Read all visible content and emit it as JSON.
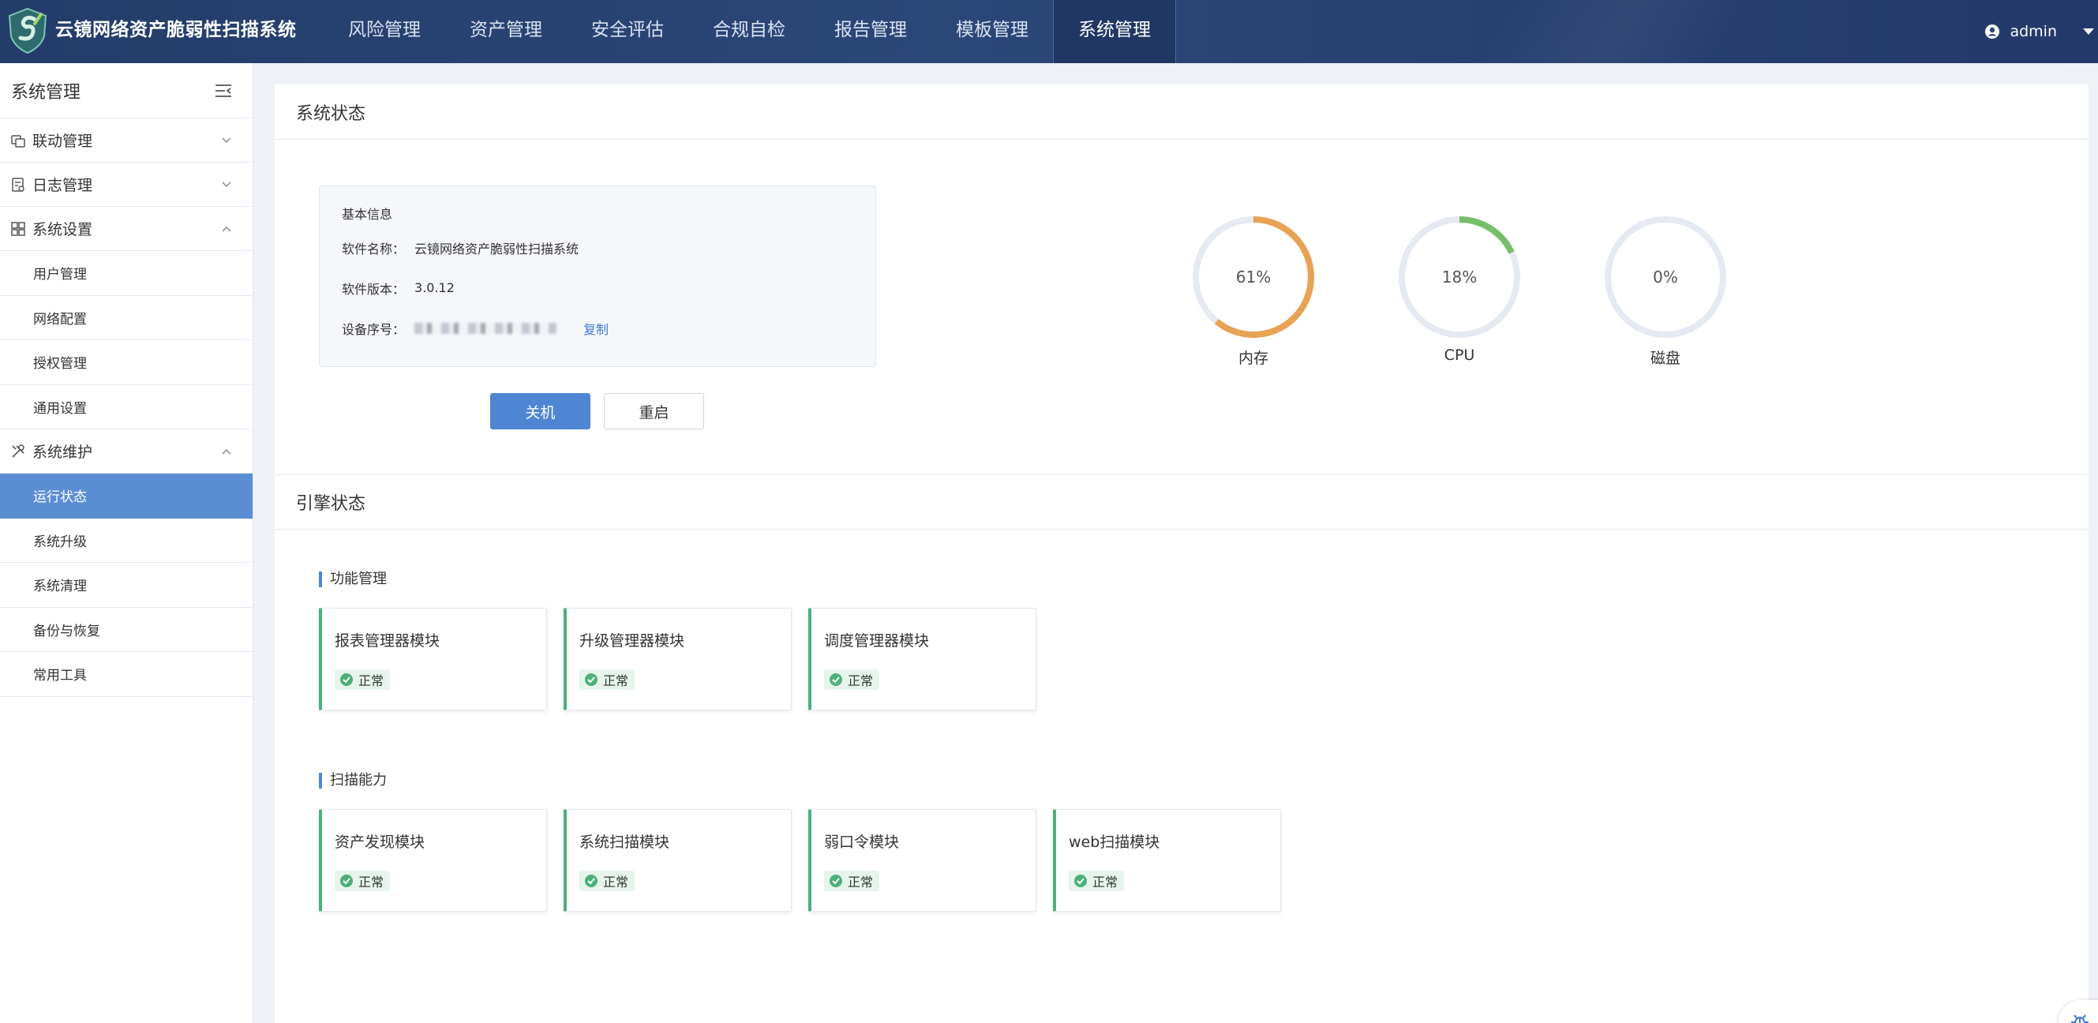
{
  "app": {
    "title": "云镜网络资产脆弱性扫描系统"
  },
  "nav": {
    "items": [
      {
        "label": "风险管理"
      },
      {
        "label": "资产管理"
      },
      {
        "label": "安全评估"
      },
      {
        "label": "合规自检"
      },
      {
        "label": "报告管理"
      },
      {
        "label": "模板管理"
      },
      {
        "label": "系统管理"
      }
    ],
    "active_index": 6
  },
  "user": {
    "name": "admin",
    "icon": "user-circle-icon"
  },
  "sidebar": {
    "title": "系统管理",
    "groups": [
      {
        "label": "联动管理",
        "icon": "linkage-icon",
        "expanded": false,
        "items": []
      },
      {
        "label": "日志管理",
        "icon": "log-icon",
        "expanded": false,
        "items": []
      },
      {
        "label": "系统设置",
        "icon": "grid-icon",
        "expanded": true,
        "items": [
          {
            "label": "用户管理"
          },
          {
            "label": "网络配置"
          },
          {
            "label": "授权管理"
          },
          {
            "label": "通用设置"
          }
        ]
      },
      {
        "label": "系统维护",
        "icon": "tools-icon",
        "expanded": true,
        "items": [
          {
            "label": "运行状态"
          },
          {
            "label": "系统升级"
          },
          {
            "label": "系统清理"
          },
          {
            "label": "备份与恢复"
          },
          {
            "label": "常用工具"
          }
        ]
      }
    ],
    "active_item": "运行状态"
  },
  "system_status": {
    "section_title": "系统状态",
    "basic_info": {
      "title": "基本信息",
      "software_name_label": "软件名称：",
      "software_name": "云镜网络资产脆弱性扫描系统",
      "software_version_label": "软件版本：",
      "software_version": "3.0.12",
      "device_serial_label": "设备序号：",
      "copy_label": "复制"
    },
    "buttons": {
      "shutdown": "关机",
      "restart": "重启"
    },
    "gauges": [
      {
        "label": "内存",
        "percent": 61,
        "display": "61%",
        "color": "#e8a253"
      },
      {
        "label": "CPU",
        "percent": 18,
        "display": "18%",
        "color": "#76bf6a"
      },
      {
        "label": "磁盘",
        "percent": 0,
        "display": "0%",
        "color": "#76bf6a"
      }
    ],
    "gauge_track_color": "#e5e9f1"
  },
  "engine_status": {
    "section_title": "引擎状态",
    "groups": [
      {
        "title": "功能管理",
        "modules": [
          {
            "name": "报表管理器模块",
            "status": "正常"
          },
          {
            "name": "升级管理器模块",
            "status": "正常"
          },
          {
            "name": "调度管理器模块",
            "status": "正常"
          }
        ]
      },
      {
        "title": "扫描能力",
        "modules": [
          {
            "name": "资产发现模块",
            "status": "正常"
          },
          {
            "name": "系统扫描模块",
            "status": "正常"
          },
          {
            "name": "弱口令模块",
            "status": "正常"
          },
          {
            "name": "web扫描模块",
            "status": "正常"
          }
        ]
      }
    ],
    "status_color": "#4cb07a"
  },
  "colors": {
    "topbar": "#2b4778",
    "accent": "#4f86d4",
    "active_menu": "#5b8dd3",
    "ok": "#4cb07a"
  }
}
